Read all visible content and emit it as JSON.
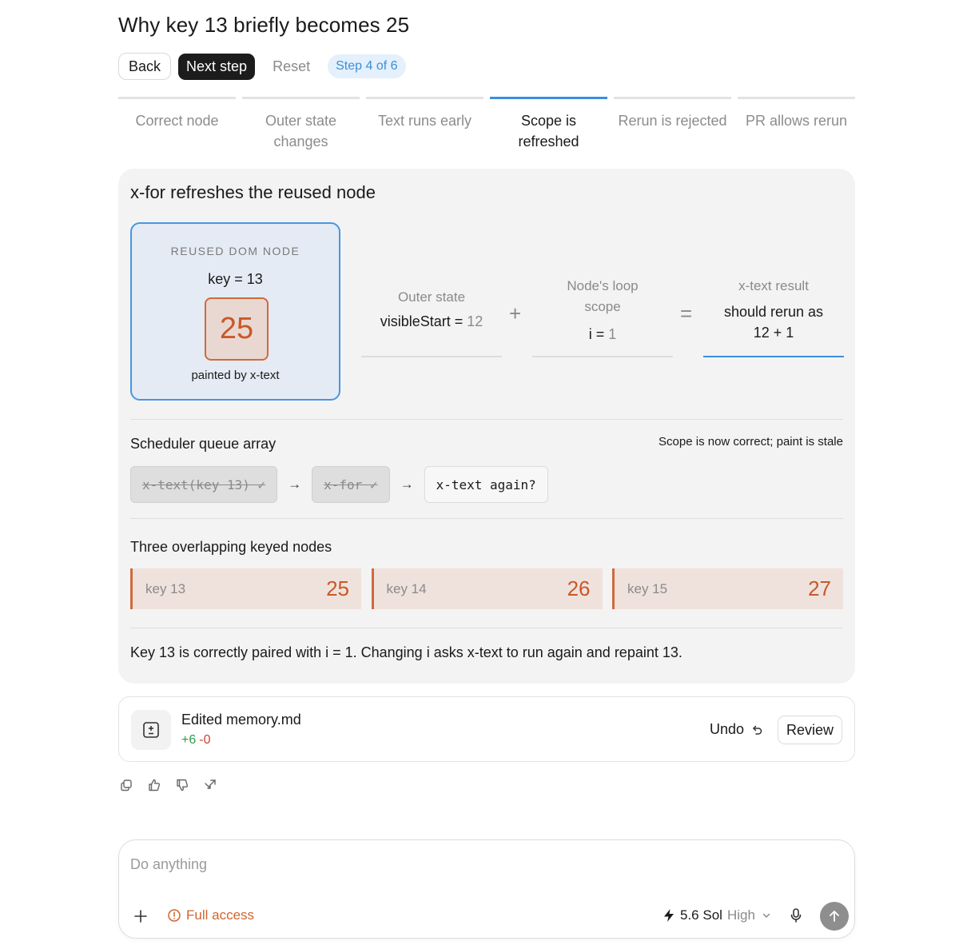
{
  "header": {
    "title": "Why key 13 briefly becomes 25",
    "back_label": "Back",
    "next_label": "Next step",
    "reset_label": "Reset",
    "step_indicator": "Step 4 of 6"
  },
  "tabs": [
    {
      "label": "Correct node",
      "active": false
    },
    {
      "label": "Outer state changes",
      "active": false
    },
    {
      "label": "Text runs early",
      "active": false
    },
    {
      "label": "Scope is refreshed",
      "active": true
    },
    {
      "label": "Rerun is rejected",
      "active": false
    },
    {
      "label": "PR allows rerun",
      "active": false
    }
  ],
  "panel": {
    "title": "x-for refreshes the reused node",
    "node": {
      "caption": "REUSED DOM NODE",
      "key_text": "key = 13",
      "value": "25",
      "painted_by": "painted by x-text"
    },
    "equation": {
      "outer": {
        "label": "Outer state",
        "value_name": "visibleStart = ",
        "value_num": "12"
      },
      "plus": "+",
      "loop": {
        "label": "Node's loop scope",
        "value_name": "i = ",
        "value_num": "1"
      },
      "equals": "=",
      "result": {
        "label": "x-text result",
        "value": "should rerun as 12 + 1"
      }
    },
    "scheduler": {
      "label": "Scheduler queue array",
      "note": "Scope is now correct; paint is stale",
      "items": [
        {
          "text": "x-text(key 13) ✓",
          "done": true
        },
        {
          "text": "x-for ✓",
          "done": true
        },
        {
          "text": "x-text again?",
          "done": false
        }
      ],
      "arrow": "→"
    },
    "keyed": {
      "label": "Three overlapping keyed nodes",
      "nodes": [
        {
          "key": "key 13",
          "value": "25"
        },
        {
          "key": "key 14",
          "value": "26"
        },
        {
          "key": "key 15",
          "value": "27"
        }
      ]
    },
    "summary": "Key 13 is correctly paired with i = 1. Changing i asks x-text to run again and repaint 13."
  },
  "edit": {
    "file": "Edited memory.md",
    "added": "+6",
    "removed": "-0",
    "undo_label": "Undo",
    "review_label": "Review"
  },
  "message_actions": [
    "copy-icon",
    "thumbs-up-icon",
    "thumbs-down-icon",
    "share-icon"
  ],
  "composer": {
    "placeholder": "Do anything",
    "access_label": "Full access",
    "model_name": "5.6 Sol",
    "effort": "High"
  },
  "colors": {
    "accent_blue": "#3b8ee0",
    "accent_orange": "#d06a3a",
    "diff_add": "#2e9a45",
    "diff_del": "#d0402f"
  }
}
